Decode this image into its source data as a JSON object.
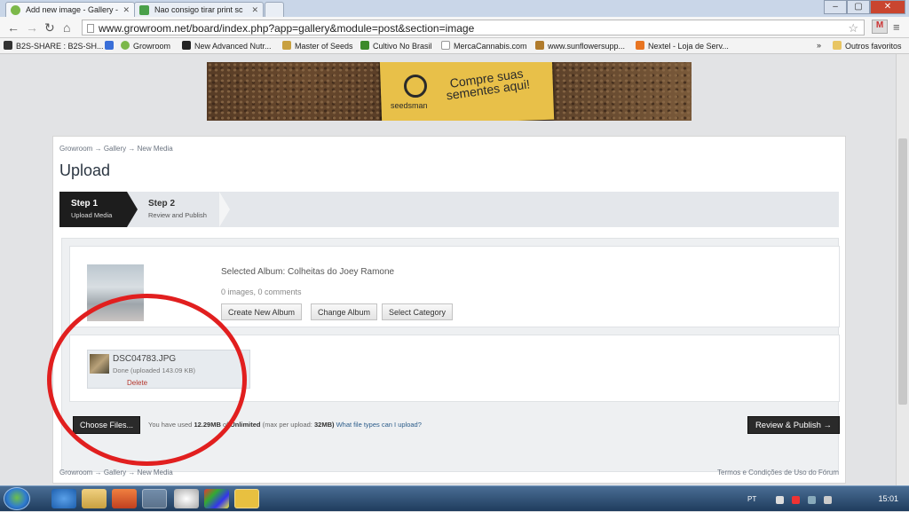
{
  "browser": {
    "tabs": [
      {
        "title": "Add new image - Gallery -",
        "active": true
      },
      {
        "title": "Nao consigo tirar print sc",
        "active": false
      }
    ],
    "url": "www.growroom.net/board/index.php?app=gallery&module=post&section=image",
    "bookmarks": [
      "B2S-SHARE : B2S-SH...",
      "Growroom",
      "New Advanced Nutr...",
      "Master of Seeds",
      "Cultivo No Brasil",
      "MercaCannabis.com",
      "www.sunflowersupp...",
      "Nextel - Loja de Serv...",
      "»",
      "Outros favoritos"
    ]
  },
  "banner": {
    "brand": "seedsman",
    "slogan": "Compre suas sementes aqui!"
  },
  "breadcrumb": [
    "Growroom",
    "→",
    "Gallery",
    "→",
    "New Media"
  ],
  "page_title": "Upload",
  "steps": [
    {
      "title": "Step 1",
      "subtitle": "Upload Media"
    },
    {
      "title": "Step 2",
      "subtitle": "Review and Publish"
    }
  ],
  "album": {
    "selected": "Selected Album: Colheitas do Joey Ramone",
    "counts": "0 images, 0 comments",
    "buttons": [
      "Create New Album",
      "Change Album",
      "Select Category"
    ]
  },
  "file": {
    "name": "DSC04783.JPG",
    "status": "Done (uploaded 143.09 KB)",
    "delete": "Delete"
  },
  "upload_bar": {
    "choose": "Choose Files...",
    "usage_prefix": "You have used",
    "used": "12.29MB",
    "of": "of",
    "limit": "Unlimited",
    "max_prefix": "(max per upload:",
    "max": "32MB)",
    "help_link": "What file types can I upload?",
    "publish": "Review & Publish →"
  },
  "footer": {
    "terms": "Termos e Condições de Uso do Fórum"
  },
  "taskbar": {
    "lang": "PT",
    "clock": "15:01"
  },
  "colors": {
    "annotation": "#e11f1f",
    "dark_button": "#2a2a2a",
    "link": "#2b5c8a"
  }
}
